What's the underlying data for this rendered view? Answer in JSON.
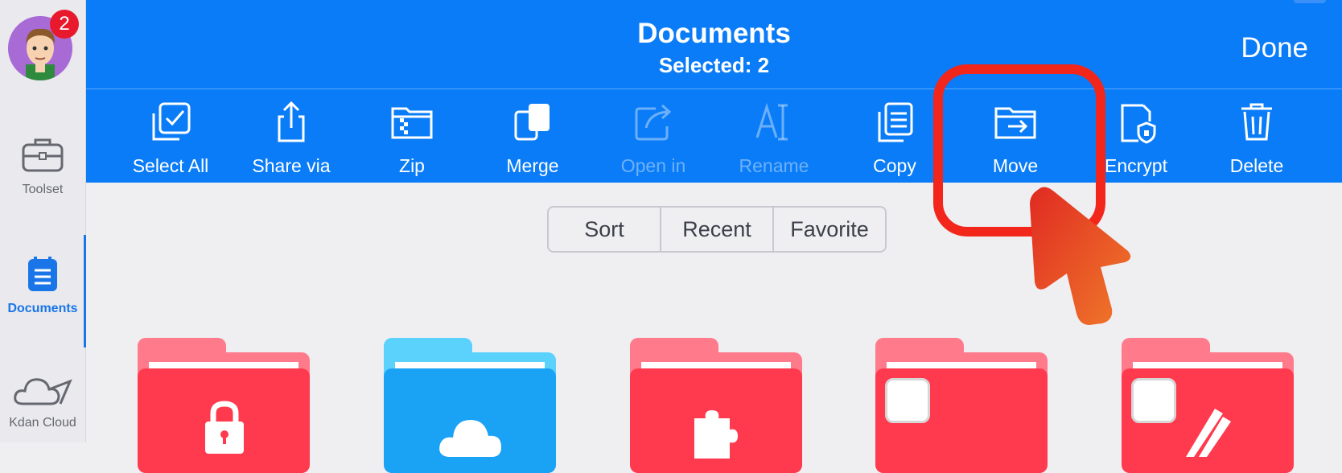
{
  "sidebar": {
    "badge_count": "2",
    "items": [
      {
        "label": "Toolset",
        "icon": "toolbox-icon"
      },
      {
        "label": "Documents",
        "icon": "document-list-icon",
        "active": true
      },
      {
        "label": "Kdan Cloud",
        "icon": "cloud-icon"
      }
    ]
  },
  "header": {
    "title": "Documents",
    "subtitle": "Selected: 2",
    "done_label": "Done"
  },
  "toolbar": {
    "items": [
      {
        "label": "Select All",
        "icon": "select-all-icon"
      },
      {
        "label": "Share via",
        "icon": "share-icon"
      },
      {
        "label": "Zip",
        "icon": "zip-icon"
      },
      {
        "label": "Merge",
        "icon": "merge-icon"
      },
      {
        "label": "Open in",
        "icon": "open-in-icon",
        "disabled": true
      },
      {
        "label": "Rename",
        "icon": "rename-icon",
        "disabled": true
      },
      {
        "label": "Copy",
        "icon": "copy-icon"
      },
      {
        "label": "Move",
        "icon": "move-icon"
      },
      {
        "label": "Encrypt",
        "icon": "encrypt-icon"
      },
      {
        "label": "Delete",
        "icon": "trash-icon"
      }
    ]
  },
  "segmented": {
    "options": [
      "Sort",
      "Recent",
      "Favorite"
    ]
  },
  "folders": [
    {
      "color": "red",
      "icon": "lock-icon"
    },
    {
      "color": "blue",
      "icon": "cloud-icon"
    },
    {
      "color": "red",
      "icon": "puzzle-icon"
    },
    {
      "color": "red",
      "icon": "app-square-icon"
    },
    {
      "color": "red",
      "icon": "app-square-icon"
    }
  ],
  "colors": {
    "accent": "#0a7cf7",
    "folder_red": "#ff3a4e",
    "folder_blue": "#1aa2f5",
    "highlight": "#f2261b"
  }
}
